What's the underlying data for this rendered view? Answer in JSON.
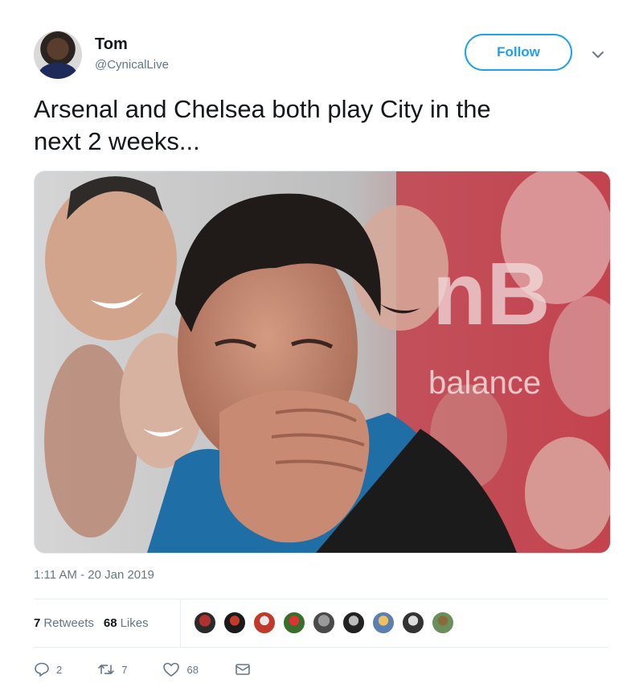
{
  "user": {
    "name": "Tom",
    "handle": "@CynicalLive"
  },
  "follow_button": {
    "label": "Follow"
  },
  "tweet": {
    "text_line1": "Arsenal and Chelsea both play City in the",
    "text_line2": "next 2 weeks...",
    "media_overlay_text": "balance",
    "timestamp": "1:11 AM - 20 Jan 2019"
  },
  "stats": {
    "retweets_count": "7",
    "retweets_label": "Retweets",
    "likes_count": "68",
    "likes_label": "Likes"
  },
  "likers_count_shown": 9,
  "actions": {
    "reply_count": "2",
    "retweet_count": "7",
    "like_count": "68"
  },
  "colors": {
    "accent": "#1da1f2",
    "text_primary": "#14171a",
    "text_secondary": "#657786",
    "divider": "#e6ecf0"
  },
  "icons": [
    "chevron-down-icon",
    "reply-icon",
    "retweet-icon",
    "like-icon",
    "direct-message-icon"
  ]
}
